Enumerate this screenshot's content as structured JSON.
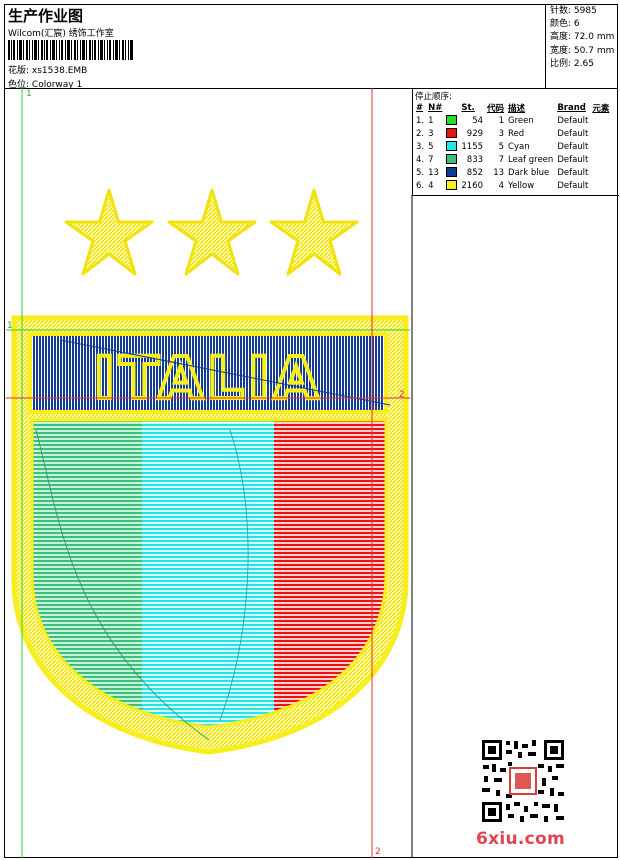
{
  "header": {
    "title": "生产作业图",
    "company": "Wilcom(汇宸) 绣饰工作室",
    "design_label": "花版:",
    "design_value": "xs1538.EMB",
    "colorway_label": "色位:",
    "colorway_value": "Colorway 1"
  },
  "stats": {
    "stitches_label": "针数:",
    "stitches_value": "5985",
    "colors_label": "颜色:",
    "colors_value": "6",
    "height_label": "高度:",
    "height_value": "72.0 mm",
    "width_label": "宽度:",
    "width_value": "50.7 mm",
    "scale_label": "比例:",
    "scale_value": "2.65"
  },
  "sequence": {
    "label": "停止顺序:",
    "headers": [
      "#",
      "N#",
      "St.",
      "代码",
      "描述",
      "Brand",
      "元素"
    ],
    "rows": [
      {
        "idx": "1.",
        "n": "1",
        "st": "54",
        "code": "1",
        "desc": "Green",
        "brand": "Default",
        "color": "#22dd22"
      },
      {
        "idx": "2.",
        "n": "3",
        "st": "929",
        "code": "3",
        "desc": "Red",
        "brand": "Default",
        "color": "#ee1111"
      },
      {
        "idx": "3.",
        "n": "5",
        "st": "1155",
        "code": "5",
        "desc": "Cyan",
        "brand": "Default",
        "color": "#22e6e6"
      },
      {
        "idx": "4.",
        "n": "7",
        "st": "833",
        "code": "7",
        "desc": "Leaf green",
        "brand": "Default",
        "color": "#3cbf7a"
      },
      {
        "idx": "5.",
        "n": "13",
        "st": "852",
        "code": "13",
        "desc": "Dark blue",
        "brand": "Default",
        "color": "#123c96"
      },
      {
        "idx": "6.",
        "n": "4",
        "st": "2160",
        "code": "4",
        "desc": "Yellow",
        "brand": "Default",
        "color": "#f7ee1c"
      }
    ]
  },
  "markers": {
    "one": "1",
    "two": "2"
  },
  "embroidery": {
    "text": "ITALIA"
  },
  "watermark": "6xiu.com"
}
